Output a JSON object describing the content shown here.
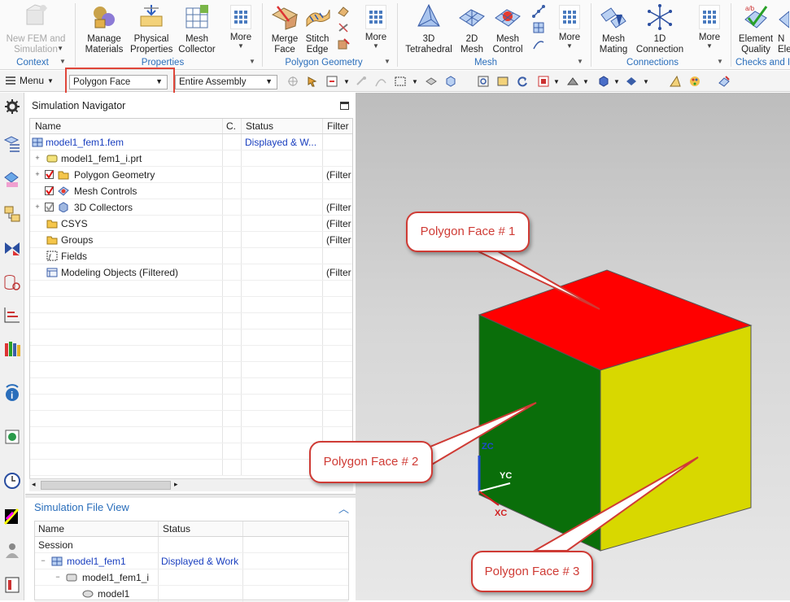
{
  "ribbon": {
    "context": {
      "button": "New FEM and Simulation",
      "button_line1": "New FEM and",
      "button_line2": "Simulation",
      "group": "Context"
    },
    "properties": {
      "buttons": [
        {
          "line1": "Manage",
          "line2": "Materials",
          "icon": "manage-materials-icon"
        },
        {
          "line1": "Physical",
          "line2": "Properties",
          "icon": "physical-properties-icon"
        },
        {
          "line1": "Mesh",
          "line2": "Collector",
          "icon": "mesh-collector-icon"
        },
        {
          "line1": "More",
          "line2": "",
          "icon": "more-icon"
        }
      ],
      "group": "Properties"
    },
    "polygon_geometry": {
      "buttons": [
        {
          "line1": "Merge",
          "line2": "Face",
          "icon": "merge-face-icon"
        },
        {
          "line1": "Stitch",
          "line2": "Edge",
          "icon": "stitch-edge-icon"
        },
        {
          "line1": "More",
          "line2": "",
          "icon": "more-icon"
        }
      ],
      "group": "Polygon Geometry"
    },
    "mesh": {
      "buttons": [
        {
          "line1": "3D",
          "line2": "Tetrahedral",
          "icon": "tetrahedral-mesh-icon"
        },
        {
          "line1": "2D",
          "line2": "Mesh",
          "icon": "2d-mesh-icon"
        },
        {
          "line1": "Mesh",
          "line2": "Control",
          "icon": "mesh-control-icon"
        },
        {
          "line1": "More",
          "line2": "",
          "icon": "more-icon"
        }
      ],
      "group": "Mesh"
    },
    "connections": {
      "buttons": [
        {
          "line1": "Mesh",
          "line2": "Mating",
          "icon": "mesh-mating-icon"
        },
        {
          "line1": "1D",
          "line2": "Connection",
          "icon": "1d-connection-icon"
        },
        {
          "line1": "More",
          "line2": "",
          "icon": "more-icon"
        }
      ],
      "group": "Connections"
    },
    "checks": {
      "buttons": [
        {
          "line1": "Element",
          "line2": "Quality",
          "icon": "element-quality-icon"
        },
        {
          "line1": "N",
          "line2": "Ele",
          "icon": "node-element-icon"
        }
      ],
      "group": "Checks and I"
    }
  },
  "toolbar": {
    "menu_label": "Menu",
    "selection_filter": "Polygon Face",
    "selection_scope": "Entire Assembly"
  },
  "navigator": {
    "title": "Simulation Navigator",
    "columns": [
      "Name",
      "C.",
      "Status",
      "Filter"
    ],
    "rows": [
      {
        "name": "model1_fem1.fem",
        "status": "Displayed & W...",
        "filter": "",
        "icon": "fem-file-icon"
      },
      {
        "name": "model1_fem1_i.prt",
        "status": "",
        "filter": "",
        "icon": "part-file-icon"
      },
      {
        "name": "Polygon Geometry",
        "status": "",
        "filter": "(Filter",
        "icon": "folder-icon"
      },
      {
        "name": "Mesh Controls",
        "status": "",
        "filter": "",
        "icon": "mesh-controls-icon"
      },
      {
        "name": "3D Collectors",
        "status": "",
        "filter": "(Filter",
        "icon": "collector-icon"
      },
      {
        "name": "CSYS",
        "status": "",
        "filter": "(Filter",
        "icon": "folder-icon"
      },
      {
        "name": "Groups",
        "status": "",
        "filter": "(Filter",
        "icon": "folder-icon"
      },
      {
        "name": "Fields",
        "status": "",
        "filter": "",
        "icon": "fields-icon"
      },
      {
        "name": "Modeling Objects (Filtered)",
        "status": "",
        "filter": "(Filter",
        "icon": "modeling-objects-icon"
      }
    ]
  },
  "file_view": {
    "title": "Simulation File View",
    "columns": [
      "Name",
      "Status"
    ],
    "rows": [
      {
        "name": "Session",
        "status": ""
      },
      {
        "name": "model1_fem1",
        "status": "Displayed & Work"
      },
      {
        "name": "model1_fem1_i",
        "status": ""
      },
      {
        "name": "model1",
        "status": ""
      }
    ]
  },
  "graphics": {
    "callouts": [
      "Polygon Face # 1",
      "Polygon Face # 2",
      "Polygon Face # 3"
    ],
    "axes": {
      "z": "ZC",
      "y": "YC",
      "x": "XC"
    },
    "colors": {
      "top": "#ff0000",
      "left": "#0a6e0a",
      "right": "#d8d800",
      "callout": "#cf3b35"
    }
  }
}
